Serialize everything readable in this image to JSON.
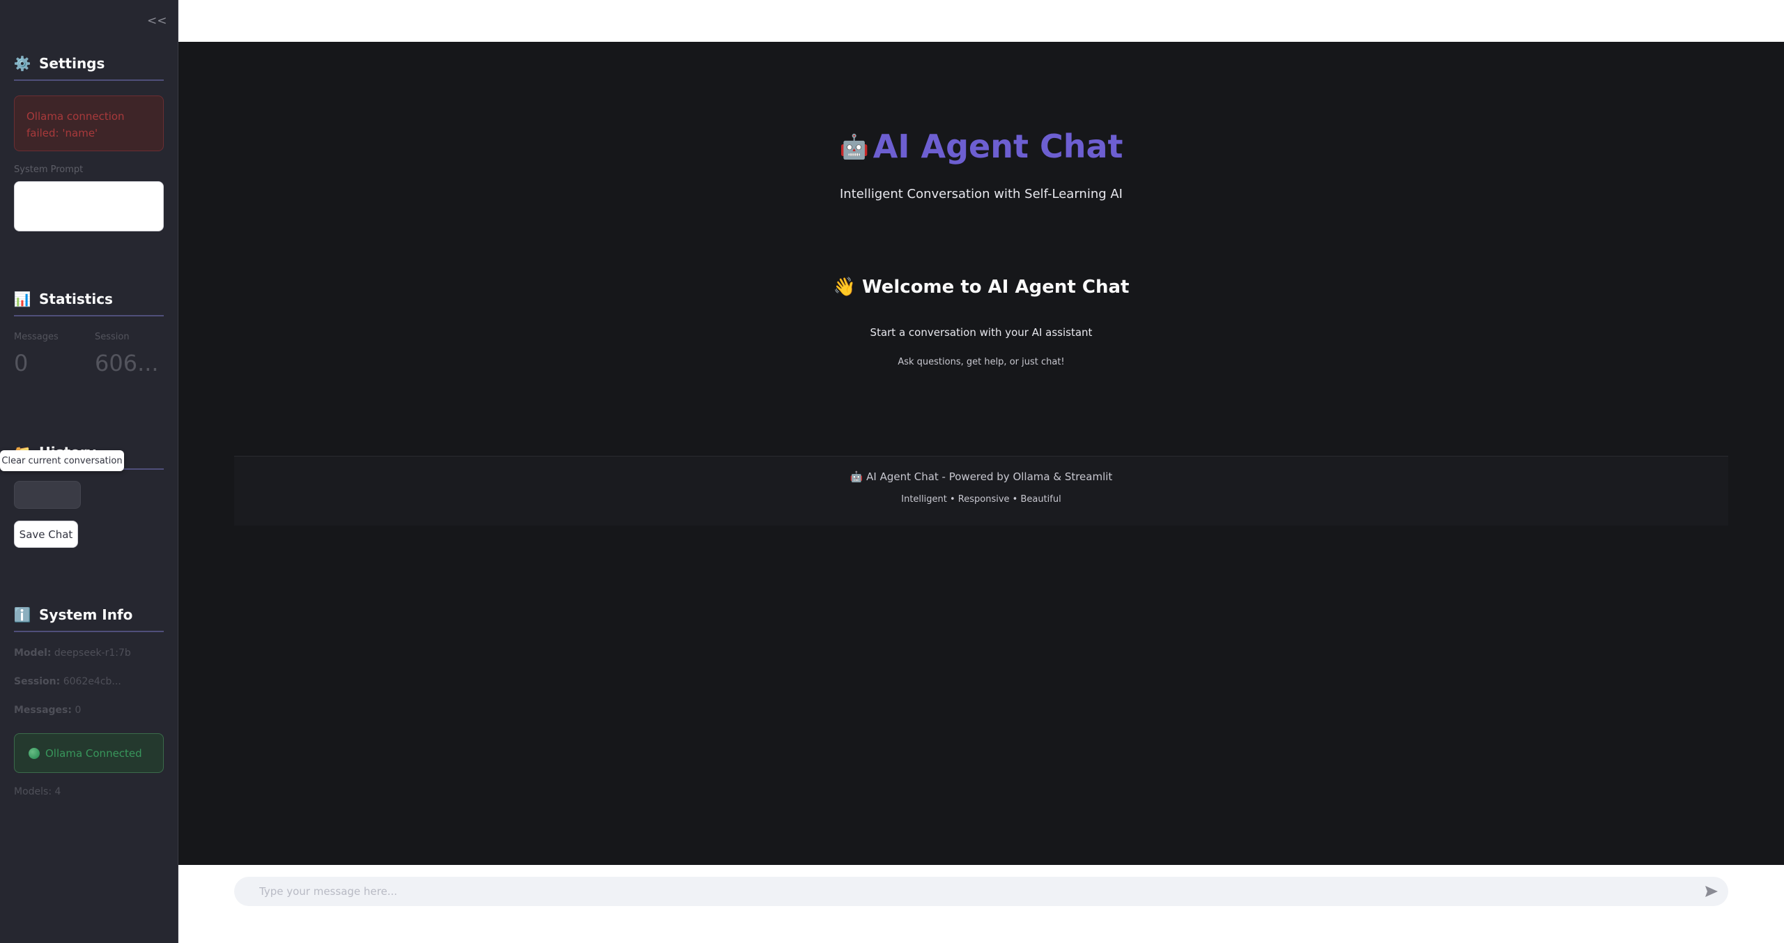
{
  "sidebar": {
    "collapse_glyph": "<<",
    "settings": {
      "emoji": "⚙️",
      "title": "Settings"
    },
    "error_text": "Ollama connection failed: 'name'",
    "system_prompt_label": "System Prompt",
    "system_prompt_value": "",
    "statistics": {
      "emoji": "📊",
      "title": "Statistics"
    },
    "metrics": [
      {
        "label": "Messages",
        "value": "0"
      },
      {
        "label": "Session",
        "value": "606..."
      }
    ],
    "history": {
      "emoji": "📁",
      "title": "History"
    },
    "tooltip": "Clear current conversation",
    "save_chat_label": "Save Chat",
    "system_info": {
      "emoji": "ℹ️",
      "title": "System Info"
    },
    "info": {
      "model_key": "Model:",
      "model_val": "deepseek-r1:7b",
      "session_key": "Session:",
      "session_val": "6062e4cb...",
      "messages_key": "Messages:",
      "messages_val": "0"
    },
    "status_text": "Ollama Connected",
    "models_text": "Models: 4"
  },
  "main": {
    "title_emoji": "🤖",
    "title": "AI Agent Chat",
    "subtitle": "Intelligent Conversation with Self-Learning AI",
    "welcome_emoji": "👋",
    "welcome": "Welcome to AI Agent Chat",
    "start_text": "Start a conversation with your AI assistant",
    "ask_text": "Ask questions, get help, or just chat!",
    "footer_line1": "🤖 AI Agent Chat - Powered by Ollama & Streamlit",
    "footer_line2": "Intelligent • Responsive • Beautiful"
  },
  "chat": {
    "placeholder": "Type your message here..."
  },
  "colors": {
    "accent": "#6d5fd1",
    "error": "#ff4b4b",
    "success": "#3fb56b",
    "sidebar_bg": "#262730",
    "main_bg": "#16171a"
  }
}
